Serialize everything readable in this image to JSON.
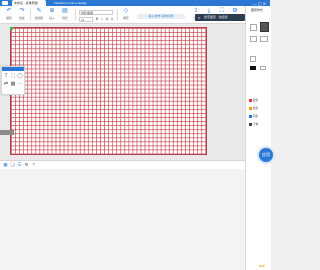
{
  "titlebar": {
    "tab_label": "未命名 - 思维导图",
    "title": "transform it into a design"
  },
  "toolbar": {
    "buttons": [
      {
        "label": "撤销",
        "icon": "undo-icon"
      },
      {
        "label": "恢复",
        "icon": "redo-icon"
      },
      {
        "label": "格式刷",
        "icon": "format-painter-icon"
      },
      {
        "label": "插入",
        "icon": "insert-icon"
      },
      {
        "label": "样式",
        "icon": "style-icon"
      },
      {
        "label": "图形",
        "icon": "shape-icon"
      }
    ],
    "font_family": "微软雅黑",
    "font_size": "12",
    "right_buttons": [
      {
        "label": "分享",
        "icon": "share-icon"
      },
      {
        "label": "导出",
        "icon": "export-icon"
      },
      {
        "label": "全屏",
        "icon": "fullscreen-icon"
      },
      {
        "label": "设置",
        "icon": "settings-icon"
      }
    ],
    "share_label": "多人协作·实时同步"
  },
  "search": {
    "placeholder": "搜索图形 · 快捷键"
  },
  "toolbox": {
    "title": "工具",
    "tools": [
      "T",
      "⬚",
      "◯",
      "⇄",
      "▦",
      "⋯"
    ]
  },
  "bottombar": {
    "icons": [
      "grid-icon",
      "layers-icon",
      "list-icon",
      "settings-icon",
      "help-icon"
    ]
  },
  "right_panel": {
    "title": "图形样式",
    "items": [
      {
        "label": "颜色",
        "color": "#e03a3a"
      },
      {
        "label": "线条",
        "color": "#ff9c00"
      },
      {
        "label": "阴影",
        "color": "#2b78d4"
      },
      {
        "label": "字体",
        "color": "#444444"
      }
    ],
    "action_label": "应用",
    "footer": "Edit"
  },
  "colors": {
    "accent": "#2b78d4",
    "grid_line": "#c84650",
    "background": "#f0f0f0"
  }
}
